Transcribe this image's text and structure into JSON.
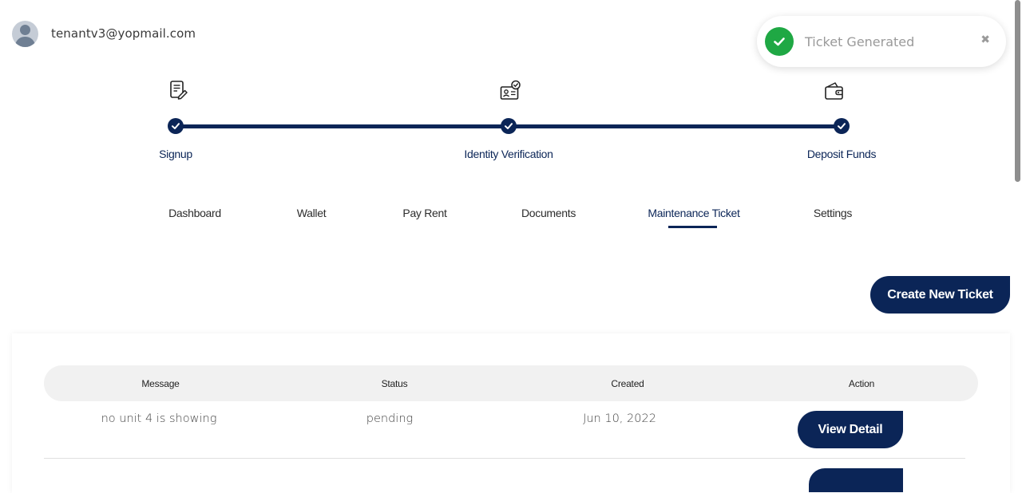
{
  "user": {
    "email": "tenantv3@yopmail.com",
    "avatar_icon": "user-avatar-icon"
  },
  "toast": {
    "message": "Ticket Generated",
    "close": "✖",
    "status_color": "#1fa844"
  },
  "stepper": {
    "steps": [
      {
        "label": "Signup",
        "icon": "signup-form-icon",
        "completed": true
      },
      {
        "label": "Identity Verification",
        "icon": "id-card-check-icon",
        "completed": true
      },
      {
        "label": "Deposit Funds",
        "icon": "wallet-icon",
        "completed": true
      }
    ]
  },
  "tabs": [
    {
      "label": "Dashboard",
      "active": false
    },
    {
      "label": "Wallet",
      "active": false
    },
    {
      "label": "Pay Rent",
      "active": false
    },
    {
      "label": "Documents",
      "active": false
    },
    {
      "label": "Maintenance Ticket",
      "active": true
    },
    {
      "label": "Settings",
      "active": false
    }
  ],
  "create_button": "Create New Ticket",
  "table": {
    "columns": [
      "Message",
      "Status",
      "Created",
      "Action"
    ],
    "rows": [
      {
        "message": "no unit 4 is showing",
        "status": "pending",
        "created": "Jun 10, 2022",
        "action": "View Detail"
      }
    ]
  },
  "colors": {
    "brand": "#0b2557",
    "header_bg": "#f1f1f1"
  }
}
